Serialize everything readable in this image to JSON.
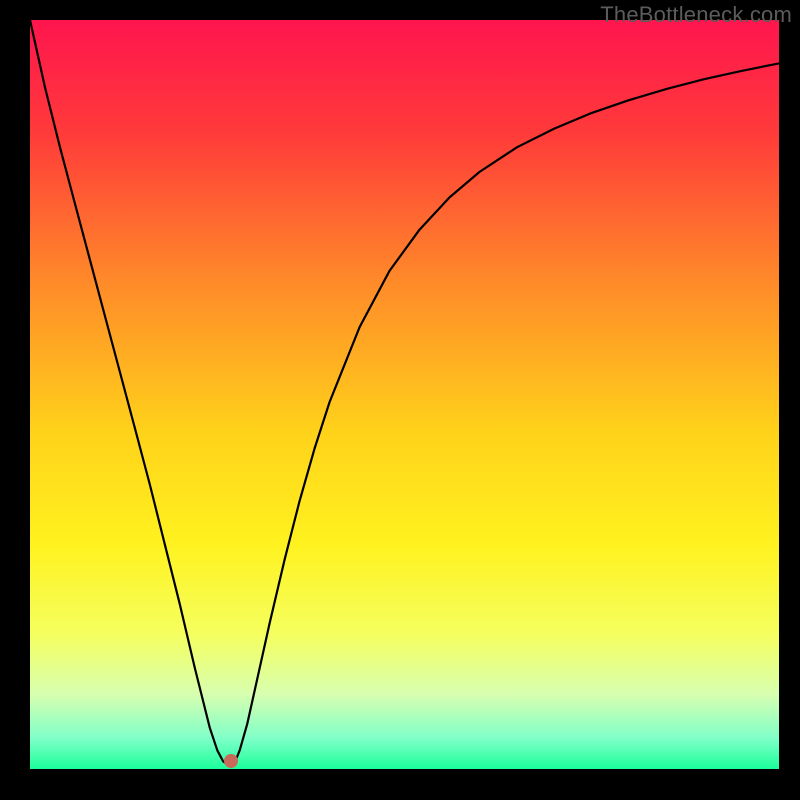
{
  "watermark": {
    "text": "TheBottleneck.com"
  },
  "gradient": {
    "stops": [
      {
        "pos": 0.0,
        "color": "#ff154e"
      },
      {
        "pos": 0.15,
        "color": "#ff3a3a"
      },
      {
        "pos": 0.35,
        "color": "#ff8a29"
      },
      {
        "pos": 0.55,
        "color": "#ffd21a"
      },
      {
        "pos": 0.7,
        "color": "#fff21f"
      },
      {
        "pos": 0.82,
        "color": "#f5ff5f"
      },
      {
        "pos": 0.9,
        "color": "#d8ffb0"
      },
      {
        "pos": 0.96,
        "color": "#7effc8"
      },
      {
        "pos": 1.0,
        "color": "#1aff9a"
      }
    ]
  },
  "marker": {
    "x_frac": 0.268,
    "y_frac": 0.989,
    "color": "#c76a5a"
  },
  "chart_data": {
    "type": "line",
    "title": "",
    "xlabel": "",
    "ylabel": "",
    "xlim": [
      0,
      1
    ],
    "ylim": [
      0,
      1
    ],
    "series": [
      {
        "name": "curve",
        "x": [
          0.0,
          0.02,
          0.04,
          0.06,
          0.08,
          0.1,
          0.12,
          0.14,
          0.16,
          0.18,
          0.2,
          0.22,
          0.24,
          0.25,
          0.258,
          0.266,
          0.274,
          0.28,
          0.29,
          0.3,
          0.32,
          0.34,
          0.36,
          0.38,
          0.4,
          0.44,
          0.48,
          0.52,
          0.56,
          0.6,
          0.65,
          0.7,
          0.75,
          0.8,
          0.85,
          0.9,
          0.95,
          1.0
        ],
        "y": [
          1.0,
          0.91,
          0.83,
          0.755,
          0.68,
          0.605,
          0.53,
          0.455,
          0.38,
          0.3,
          0.22,
          0.135,
          0.055,
          0.025,
          0.01,
          0.005,
          0.01,
          0.025,
          0.06,
          0.105,
          0.195,
          0.28,
          0.358,
          0.428,
          0.49,
          0.59,
          0.665,
          0.72,
          0.763,
          0.797,
          0.83,
          0.855,
          0.876,
          0.893,
          0.908,
          0.921,
          0.932,
          0.942
        ]
      }
    ]
  }
}
